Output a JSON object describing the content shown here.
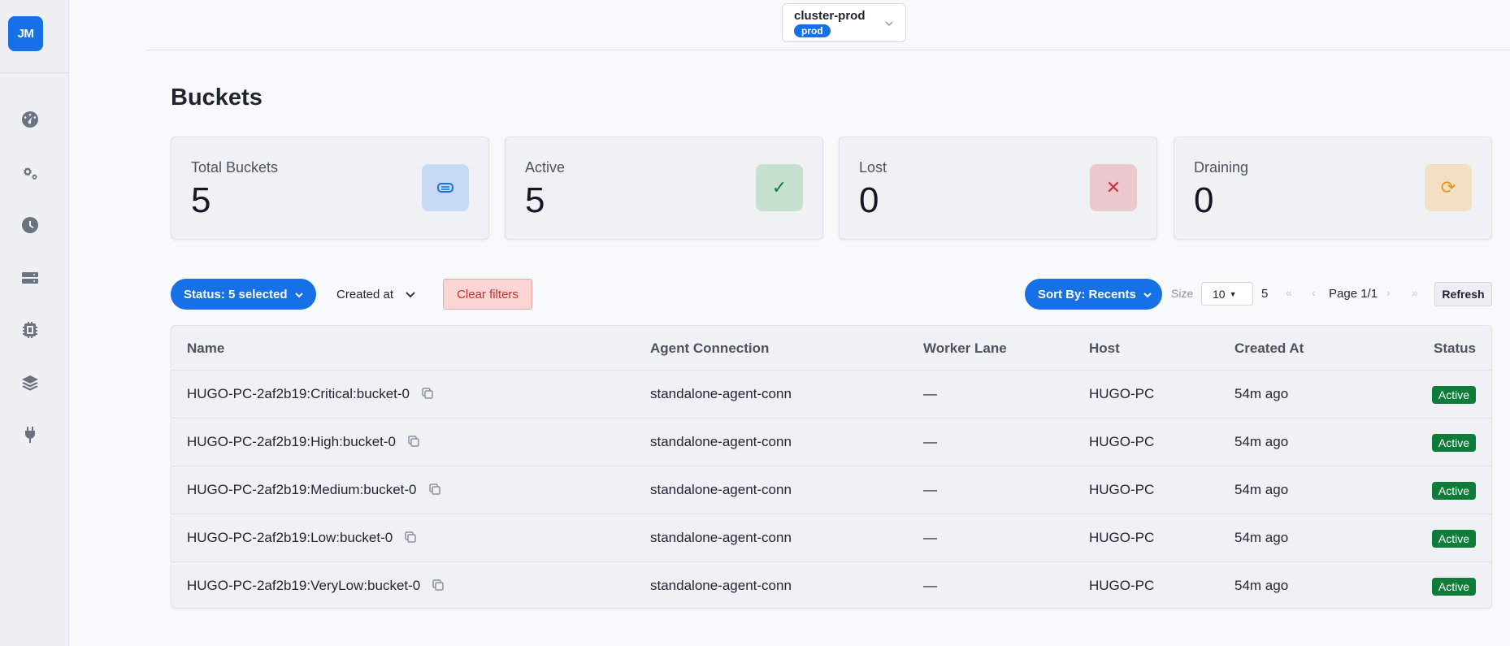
{
  "app": {
    "logo_text": "JM"
  },
  "sidebar": {
    "icons": [
      "dashboard-icon",
      "settings-gears-icon",
      "clock-icon",
      "server-icon",
      "cpu-chip-icon",
      "layers-icon",
      "plug-icon"
    ]
  },
  "cluster": {
    "name": "cluster-prod",
    "env": "prod"
  },
  "page": {
    "title": "Buckets"
  },
  "stats": [
    {
      "label": "Total Buckets",
      "value": "5",
      "icon": "bucket-icon",
      "icon_bg": "#c6daf5",
      "icon_color": "#1670e6"
    },
    {
      "label": "Active",
      "value": "5",
      "icon": "check-icon",
      "icon_glyph": "✓",
      "icon_bg": "#c5e0cf",
      "icon_color": "#107c3a"
    },
    {
      "label": "Lost",
      "value": "0",
      "icon": "x-icon",
      "icon_glyph": "✕",
      "icon_bg": "#ecc8cf",
      "icon_color": "#d0303f"
    },
    {
      "label": "Draining",
      "value": "0",
      "icon": "refresh-icon",
      "icon_glyph": "⟳",
      "icon_bg": "#f3dfc4",
      "icon_color": "#e8951f"
    }
  ],
  "filters": {
    "status_label": "Status: 5 selected",
    "created_label": "Created at",
    "clear_label": "Clear filters",
    "sort_label": "Sort By: Recents"
  },
  "pagination": {
    "size_label": "Size",
    "size_value": "10",
    "total": "5",
    "first": "«",
    "prev": "‹",
    "page_label": "Page 1/1",
    "next": "›",
    "last": "»",
    "refresh_label": "Refresh"
  },
  "table": {
    "headers": [
      "Name",
      "Agent Connection",
      "Worker Lane",
      "Host",
      "Created At",
      "Status"
    ],
    "rows": [
      {
        "name": "HUGO-PC-2af2b19:Critical:bucket-0",
        "agent": "standalone-agent-conn",
        "lane": "—",
        "host": "HUGO-PC",
        "created": "54m ago",
        "status": "Active"
      },
      {
        "name": "HUGO-PC-2af2b19:High:bucket-0",
        "agent": "standalone-agent-conn",
        "lane": "—",
        "host": "HUGO-PC",
        "created": "54m ago",
        "status": "Active"
      },
      {
        "name": "HUGO-PC-2af2b19:Medium:bucket-0",
        "agent": "standalone-agent-conn",
        "lane": "—",
        "host": "HUGO-PC",
        "created": "54m ago",
        "status": "Active"
      },
      {
        "name": "HUGO-PC-2af2b19:Low:bucket-0",
        "agent": "standalone-agent-conn",
        "lane": "—",
        "host": "HUGO-PC",
        "created": "54m ago",
        "status": "Active"
      },
      {
        "name": "HUGO-PC-2af2b19:VeryLow:bucket-0",
        "agent": "standalone-agent-conn",
        "lane": "—",
        "host": "HUGO-PC",
        "created": "54m ago",
        "status": "Active"
      }
    ]
  },
  "colors": {
    "accent": "#1670e6",
    "active_status": "#107c3a",
    "clear_bg": "#fcd5d5",
    "clear_text": "#c53030"
  }
}
